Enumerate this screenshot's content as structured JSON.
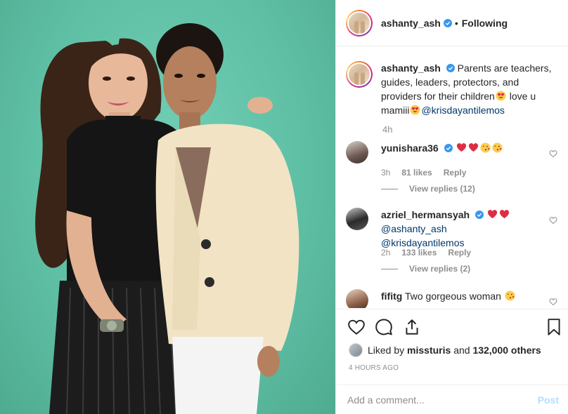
{
  "header": {
    "username": "ashanty_ash",
    "separator": "•",
    "follow_status": "Following"
  },
  "caption": {
    "username": "ashanty_ash",
    "text_part1": "Parents are teachers, guides, leaders, protectors, and providers for their children",
    "text_part2": "love u mamiii",
    "mention": "@krisdayantilemos",
    "time": "4h"
  },
  "comments": [
    {
      "username": "yunishara36",
      "text": "",
      "emojis": [
        "red-heart",
        "red-heart",
        "kissing-face",
        "kissing-face"
      ],
      "time": "3h",
      "likes": "81 likes",
      "reply_label": "Reply",
      "view_replies": "View replies (12)"
    },
    {
      "username": "azriel_hermansyah",
      "text": "",
      "mentions": "@ashanty_ash @krisdayantilemos",
      "emojis": [
        "red-heart",
        "red-heart"
      ],
      "time": "2h",
      "likes": "133 likes",
      "reply_label": "Reply",
      "view_replies": "View replies (2)"
    },
    {
      "username": "fifitg",
      "text": "Two gorgeous woman",
      "emojis": [
        "kissing-face"
      ]
    }
  ],
  "likes": {
    "prefix": "Liked by",
    "user": "missturis",
    "middle": "and",
    "count": "132,000 others"
  },
  "timestamp": "4 HOURS AGO",
  "add_comment": {
    "placeholder": "Add a comment...",
    "post_label": "Post"
  },
  "colors": {
    "verified": "#3897f0",
    "link": "#00376b",
    "post_disabled": "#b2dffc",
    "photo_background": "#62c4a8"
  }
}
